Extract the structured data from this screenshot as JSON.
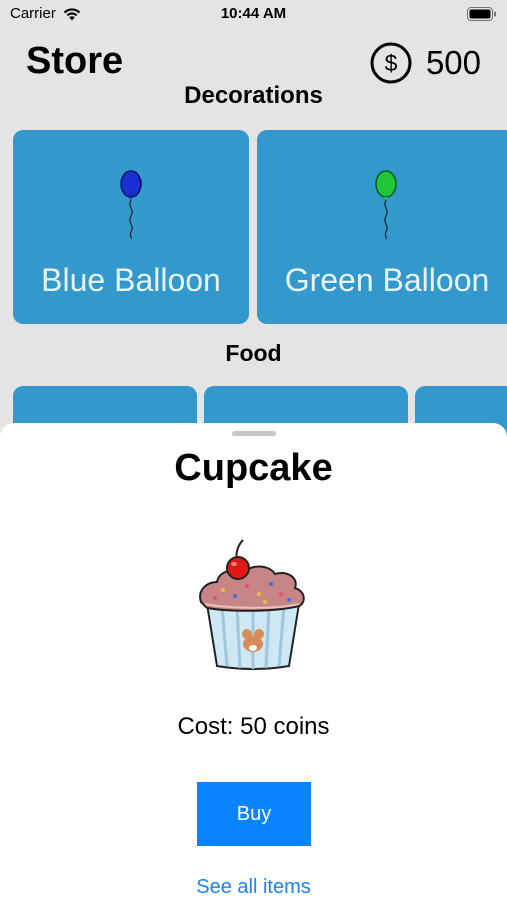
{
  "status_bar": {
    "carrier": "Carrier",
    "time": "10:44 AM"
  },
  "header": {
    "title": "Store",
    "coin_icon_label": "$",
    "coin_balance": "500"
  },
  "sections": {
    "decorations": {
      "heading": "Decorations",
      "items": [
        {
          "label": "Blue Balloon",
          "icon": "balloon-icon",
          "color": "#1a2fd0"
        },
        {
          "label": "Green Balloon",
          "icon": "balloon-icon",
          "color": "#22c43a"
        }
      ]
    },
    "food": {
      "heading": "Food"
    }
  },
  "sheet": {
    "title": "Cupcake",
    "image": "cupcake-icon",
    "cost_text": "Cost: 50 coins",
    "buy_label": "Buy",
    "see_all_label": "See all items"
  },
  "colors": {
    "card_background": "#3399cc",
    "accent_blue": "#0a84ff",
    "screen_background": "#e4e4e4"
  }
}
